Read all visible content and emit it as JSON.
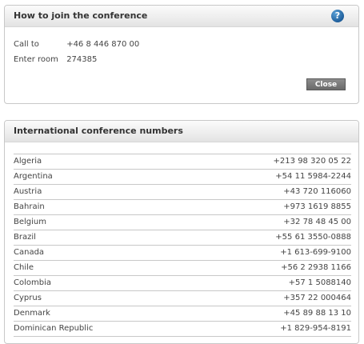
{
  "join_panel": {
    "title": "How to join the conference",
    "help_icon": "?",
    "call_label": "Call to",
    "call_value": "+46 8 446 870 00",
    "room_label": "Enter room",
    "room_value": "274385",
    "close_label": "Close"
  },
  "intl_panel": {
    "title": "International conference numbers",
    "rows": [
      {
        "country": "Algeria",
        "number": "+213 98 320 05 22"
      },
      {
        "country": "Argentina",
        "number": "+54 11 5984-2244"
      },
      {
        "country": "Austria",
        "number": "+43 720 116060"
      },
      {
        "country": "Bahrain",
        "number": "+973 1619 8855"
      },
      {
        "country": "Belgium",
        "number": "+32 78 48 45 00"
      },
      {
        "country": "Brazil",
        "number": "+55 61 3550-0888"
      },
      {
        "country": "Canada",
        "number": "+1 613-699-9100"
      },
      {
        "country": "Chile",
        "number": "+56 2 2938 1166"
      },
      {
        "country": "Colombia",
        "number": "+57 1 5088140"
      },
      {
        "country": "Cyprus",
        "number": "+357 22 000464"
      },
      {
        "country": "Denmark",
        "number": "+45 89 88 13 10"
      },
      {
        "country": "Dominican Republic",
        "number": "+1 829-954-8191"
      }
    ]
  },
  "colors": {
    "close_button": "#6a6a6a",
    "help_icon": "#1f5f9c"
  },
  "icons": {
    "help": "help-icon"
  }
}
